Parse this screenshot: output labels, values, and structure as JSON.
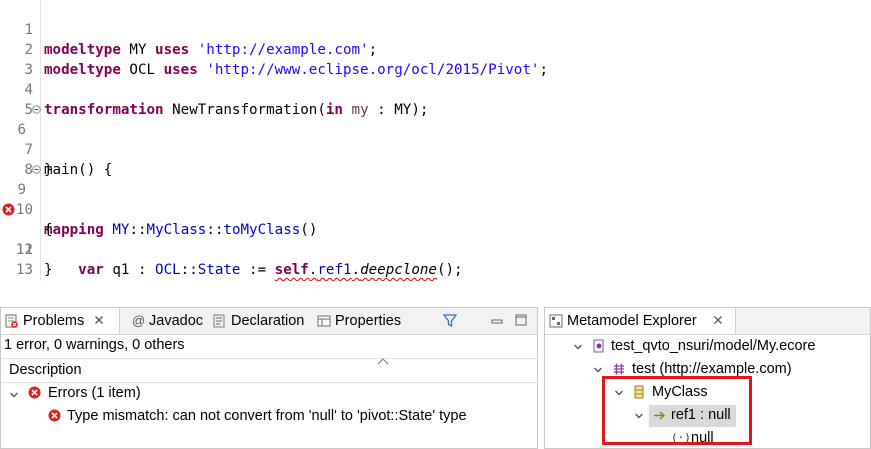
{
  "editor": {
    "lines": [
      {
        "n": "1"
      },
      {
        "n": "2"
      },
      {
        "n": "3"
      },
      {
        "n": "4"
      },
      {
        "n": "5"
      },
      {
        "n": "6"
      },
      {
        "n": "7"
      },
      {
        "n": "8"
      },
      {
        "n": "9"
      },
      {
        "n": "10"
      },
      {
        "n": "11"
      },
      {
        "n": "12"
      },
      {
        "n": "13"
      }
    ],
    "code": {
      "l1": {
        "kw": "modeltype",
        "t1": " MY ",
        "kw2": "uses",
        "t2": " ",
        "str": "'http://example.com'",
        "t3": ";"
      },
      "l2": {
        "kw": "modeltype",
        "t1": " OCL ",
        "kw2": "uses",
        "t2": " ",
        "str": "'http://www.eclipse.org/ocl/2015/Pivot'",
        "t3": ";"
      },
      "l4": {
        "kw": "transformation",
        "t1": " NewTransformation(",
        "kw2": "in",
        "t2": " ",
        "var": "my",
        "t3": " : MY);"
      },
      "l6": {
        "t1": "main() {"
      },
      "l7": {
        "t1": "}"
      },
      "l9": {
        "kw": "mapping",
        "t1": " ",
        "ty1": "MY",
        "t2": "::",
        "ty2": "MyClass",
        "t3": "::",
        "fn": "toMyClass",
        "t4": "()"
      },
      "l10": {
        "t1": "{"
      },
      "l11": {
        "indent": "    ",
        "kw": "var",
        "t1": " q1 : ",
        "ty1": "OCL",
        "t2": "::",
        "ty2": "State",
        "t3": " := ",
        "kw2": "self",
        "t4": ".",
        "fld": "ref1",
        "t5": ".",
        "op": "deepclone",
        "t6": "();"
      },
      "l12": {
        "t1": "}"
      }
    }
  },
  "problems": {
    "tabs": {
      "problems": "Problems",
      "javadoc": "Javadoc",
      "declaration": "Declaration",
      "properties": "Properties"
    },
    "summary": "1 error, 0 warnings, 0 others",
    "column_header": "Description",
    "group_label": "Errors (1 item)",
    "error_message": "Type mismatch: can not convert from 'null' to 'pivot::State' type"
  },
  "metamodel": {
    "tab": "Metamodel Explorer",
    "tree": {
      "root": "test_qvto_nsuri/model/My.ecore",
      "package": "test (http://example.com)",
      "class": "MyClass",
      "reference": "ref1 : null",
      "value": "null"
    }
  },
  "colors": {
    "keyword": "#7f0055",
    "string": "#2a00ff",
    "type": "#0000c0",
    "error": "#e02020",
    "highlight_box": "#e8141b",
    "selection": "#d9d9d9"
  }
}
